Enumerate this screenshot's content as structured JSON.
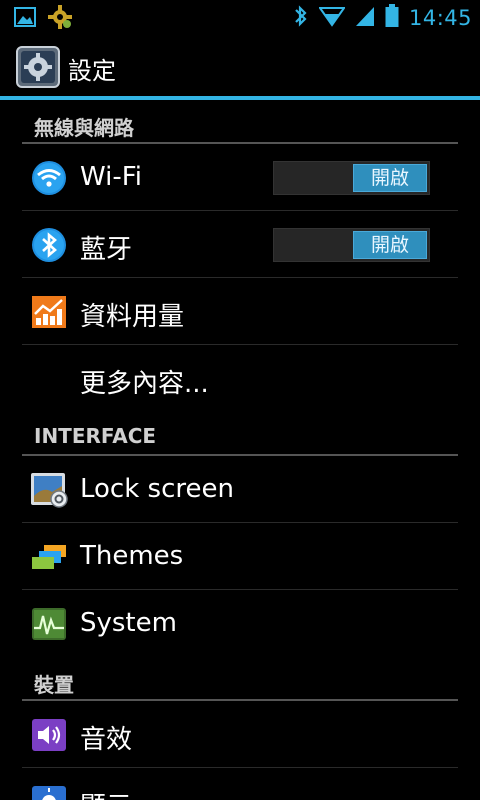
{
  "status_bar": {
    "time": "14:45",
    "icons": [
      "gallery-notification-icon",
      "settings-gear-notification-icon",
      "bluetooth-icon",
      "wifi-signal-icon",
      "cellular-signal-icon",
      "battery-icon"
    ]
  },
  "action_bar": {
    "title": "設定",
    "icon": "settings-app-icon"
  },
  "sections": [
    {
      "header": "無線與網路",
      "items": [
        {
          "label": "Wi-Fi",
          "icon": "wifi-icon",
          "switch": "開啟"
        },
        {
          "label": "藍牙",
          "icon": "bluetooth-icon",
          "switch": "開啟"
        },
        {
          "label": "資料用量",
          "icon": "data-usage-icon"
        },
        {
          "label": "更多內容..."
        }
      ]
    },
    {
      "header": "INTERFACE",
      "items": [
        {
          "label": "Lock screen",
          "icon": "lock-screen-icon"
        },
        {
          "label": "Themes",
          "icon": "themes-icon"
        },
        {
          "label": "System",
          "icon": "system-icon"
        }
      ]
    },
    {
      "header": "裝置",
      "items": [
        {
          "label": "音效",
          "icon": "sound-icon"
        },
        {
          "label": "顯示",
          "icon": "display-icon"
        }
      ]
    }
  ],
  "colors": {
    "accent": "#33b5e5",
    "switch_on": "#2f8fbd",
    "background": "#000000"
  }
}
